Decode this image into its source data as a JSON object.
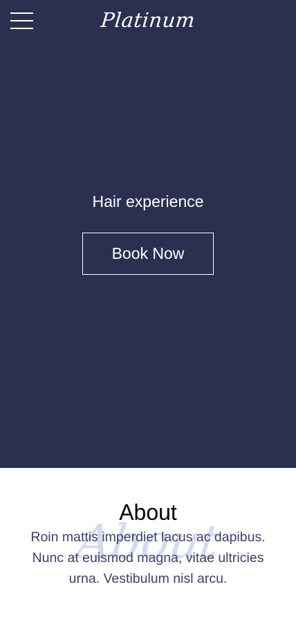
{
  "header": {
    "logo_text": "Platinum",
    "menu_icon": "hamburger-menu-icon"
  },
  "hero": {
    "tagline": "Hair experience",
    "cta_label": "Book Now"
  },
  "about": {
    "title": "About",
    "watermark": "About",
    "body": "Roin mattis imperdiet lacus ac dapibus. Nunc at euismod magna, vitae ultricies urna. Vestibulum nisl arcu."
  },
  "colors": {
    "hero_background": "#2b2f50",
    "text_light": "#ffffff",
    "body_text": "#3b3f6b",
    "watermark": "#c9cdee"
  }
}
